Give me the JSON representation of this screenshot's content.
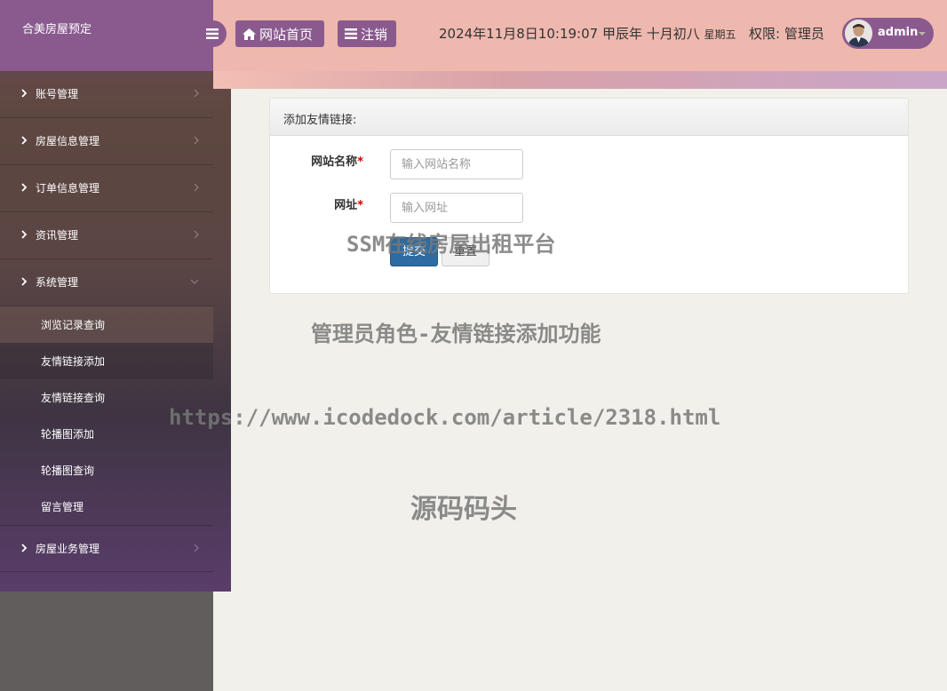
{
  "app": {
    "title": "合美房屋预定"
  },
  "header": {
    "home_label": "网站首页",
    "logout_label": "注销",
    "datetime": "2024年11月8日10:19:07 甲辰年 十月初八",
    "weekday": "星期五",
    "permission": "权限: 管理员",
    "username": "admin"
  },
  "sidebar": {
    "items": [
      {
        "label": "账号管理"
      },
      {
        "label": "房屋信息管理"
      },
      {
        "label": "订单信息管理"
      },
      {
        "label": "资讯管理"
      },
      {
        "label": "系统管理"
      },
      {
        "label": "房屋业务管理"
      }
    ],
    "system_sub": [
      {
        "label": "浏览记录查询"
      },
      {
        "label": "友情链接添加"
      },
      {
        "label": "友情链接查询"
      },
      {
        "label": "轮播图添加"
      },
      {
        "label": "轮播图查询"
      },
      {
        "label": "留言管理"
      }
    ]
  },
  "form": {
    "title": "添加友情链接:",
    "name_label": "网站名称",
    "name_placeholder": "输入网站名称",
    "url_label": "网址",
    "url_placeholder": "输入网址",
    "required_mark": "*",
    "submit_label": "提交",
    "reset_label": "重置"
  },
  "watermarks": {
    "platform": "SSM在线房屋出租平台",
    "feature": "管理员角色-友情链接添加功能",
    "url": "https://www.icodedock.com/article/2318.html",
    "source": "源码码头"
  },
  "colors": {
    "accent": "#8a5a8e",
    "header_bg": "#eeb8ae",
    "primary_button": "#2d6ba0"
  }
}
